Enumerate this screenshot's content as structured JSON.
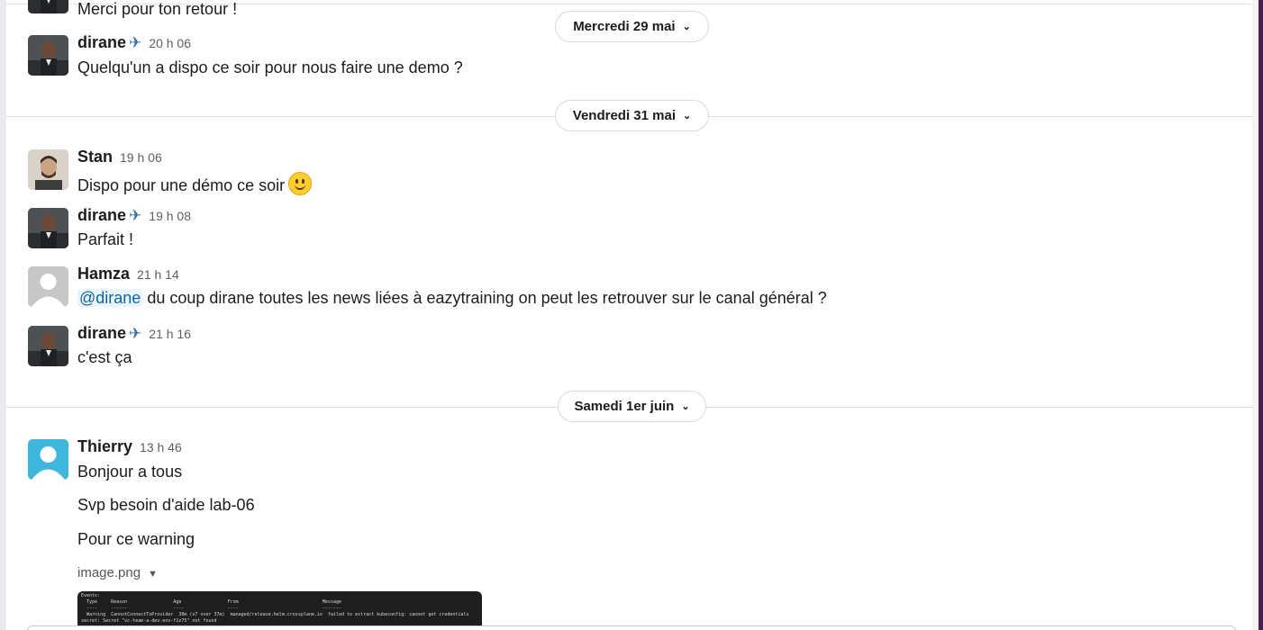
{
  "dates": {
    "wed": "Mercredi 29 mai",
    "fri": "Vendredi 31 mai",
    "sat": "Samedi 1er juin"
  },
  "icons": {
    "chevron": "chevron-down-icon",
    "airplane": "airplane-icon",
    "dropdown": "caret-down-icon",
    "emoji": "slightly-smiling-face-icon"
  },
  "messages": [
    {
      "text": "Merci pour ton retour !"
    },
    {
      "author": "dirane",
      "time": "20 h 06",
      "text": "Quelqu'un a dispo ce soir pour nous faire une demo ?"
    },
    {
      "author": "Stan",
      "time": "19 h 06",
      "text": "Dispo pour une démo ce soir"
    },
    {
      "author": "dirane",
      "time": "19 h 08",
      "text": "Parfait !"
    },
    {
      "author": "Hamza",
      "time": "21 h 14",
      "mention": "@dirane",
      "text": " du coup dirane toutes les news liées à eazytraining on peut les retrouver sur le canal général ?"
    },
    {
      "author": "dirane",
      "time": "21 h 16",
      "text": "c'est ça"
    },
    {
      "author": "Thierry",
      "time": "13 h 46",
      "lines": [
        "Bonjour a tous",
        "Svp besoin d'aide lab-06",
        "Pour ce warning"
      ]
    }
  ],
  "attachment": {
    "filename": "image.png",
    "terminal": [
      "Events:",
      "  Type     Reason                 Age                 From                               Message",
      "  ----     ------                 ----                ----                               -------",
      "  Warning  CannotConnectToProvider  30m (x7 over 37m)  managed/release.helm.crossplane.io  failed to extract kubeconfig: cannot get credentials",
      "secret: Secret \"vc-team-a-dev-env-f2z75\" not found"
    ]
  },
  "colors": {
    "mention_bg": "#e8f5fa",
    "mention_text": "#1264a3",
    "sidebar_accent": "#4a1f4a"
  }
}
